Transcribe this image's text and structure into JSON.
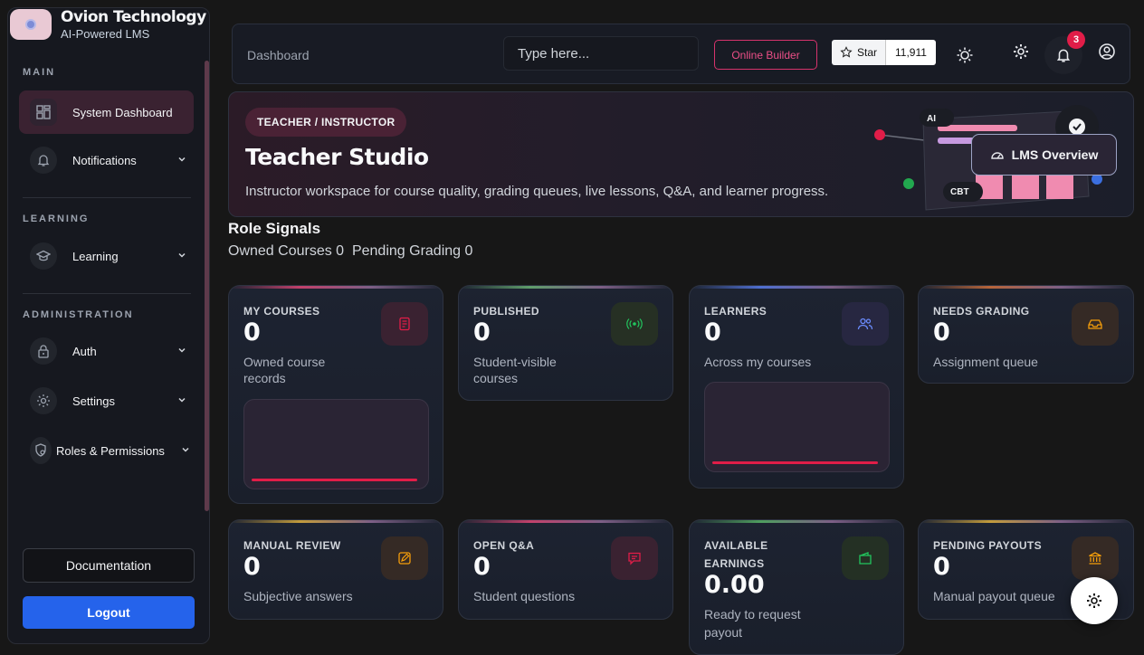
{
  "brand": {
    "name": "Ovion Technology",
    "subtitle": "AI-Powered LMS"
  },
  "sidebar": {
    "sections": {
      "main": "MAIN",
      "learning": "LEARNING",
      "administration": "ADMINISTRATION"
    },
    "items": [
      {
        "label": "System Dashboard",
        "icon": "dashboard-icon",
        "active": true
      },
      {
        "label": "Notifications",
        "icon": "bell-icon"
      },
      {
        "label": "Learning",
        "icon": "graduation-cap-icon"
      },
      {
        "label": "Auth",
        "icon": "lock-icon"
      },
      {
        "label": "Settings",
        "icon": "gear-icon"
      },
      {
        "label": "Roles & Permissions",
        "icon": "shield-user-icon"
      }
    ],
    "documentation": "Documentation",
    "logout": "Logout"
  },
  "topbar": {
    "breadcrumb": "Dashboard",
    "search_placeholder": "Type here...",
    "builder_label": "Online Builder",
    "star_label": "Star",
    "star_count": "11,911",
    "notification_count": "3"
  },
  "hero": {
    "role_chip": "TEACHER / INSTRUCTOR",
    "title": "Teacher Studio",
    "description": "Instructor workspace for course quality, grading queues, live lessons, Q&A, and learner progress.",
    "overview_button": "LMS Overview",
    "illustration_labels": {
      "ai": "AI",
      "cbt": "CBT"
    }
  },
  "role_signals": {
    "title": "Role Signals",
    "summary": "Owned Courses 0  Pending Grading 0"
  },
  "cards": [
    {
      "title": "MY COURSES",
      "value": "0",
      "desc": "Owned course records",
      "icon": "book-icon",
      "accent": "#c2416b",
      "progress": 1.0
    },
    {
      "title": "PUBLISHED",
      "value": "0",
      "desc": "Student-visible courses",
      "icon": "broadcast-icon",
      "accent": "#5f9e6b"
    },
    {
      "title": "LEARNERS",
      "value": "0",
      "desc": "Across my courses",
      "icon": "users-icon",
      "accent": "#4f6fd1",
      "progress": 1.0
    },
    {
      "title": "NEEDS GRADING",
      "value": "0",
      "desc": "Assignment queue",
      "icon": "inbox-icon",
      "accent": "#b7653a"
    },
    {
      "title": "MANUAL REVIEW",
      "value": "0",
      "desc": "Subjective answers",
      "icon": "edit-icon",
      "accent": "#c29b3c"
    },
    {
      "title": "OPEN Q&A",
      "value": "0",
      "desc": "Student questions",
      "icon": "chat-icon",
      "accent": "#c2416b"
    },
    {
      "title": "AVAILABLE EARNINGS",
      "value": "0.00",
      "desc": "Ready to request payout",
      "icon": "wallet-icon",
      "accent": "#4f9e5f"
    },
    {
      "title": "PENDING PAYOUTS",
      "value": "0",
      "desc": "Manual payout queue",
      "icon": "bank-icon",
      "accent": "#c29b3c"
    }
  ],
  "colors": {
    "primary": "#2563eb",
    "pink": "#e11d48",
    "surface": "#1a1f2b"
  }
}
